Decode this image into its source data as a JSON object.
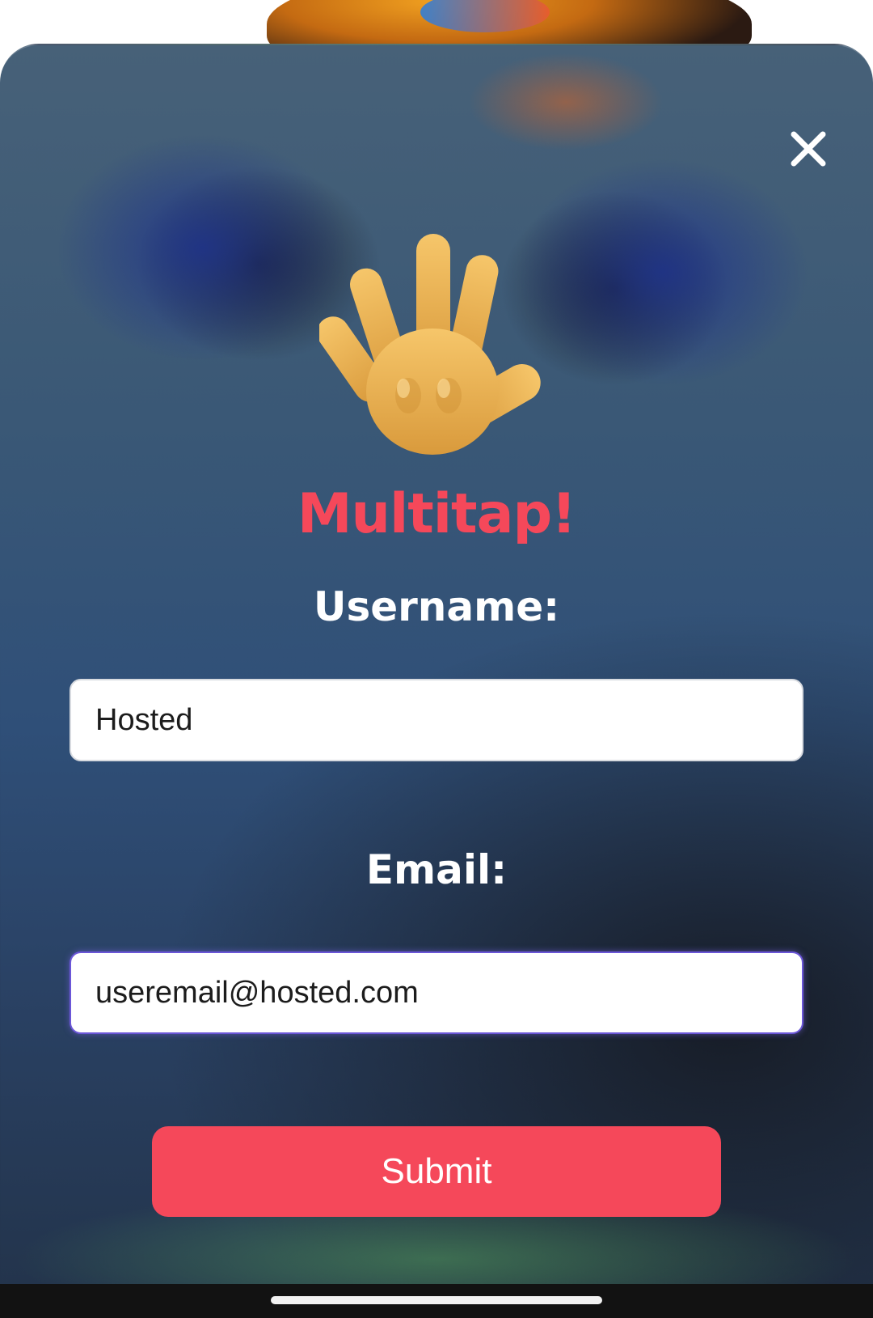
{
  "modal": {
    "title": "Multitap!",
    "close_icon": "close-icon",
    "wave_icon": "waving-hand-icon"
  },
  "form": {
    "username_label": "Username:",
    "username_value": "Hosted",
    "email_label": "Email:",
    "email_value": "useremail@hosted.com",
    "submit_label": "Submit"
  },
  "colors": {
    "accent": "#f5485a",
    "focus_border": "#6b56d8",
    "label_text": "#ffffff"
  }
}
